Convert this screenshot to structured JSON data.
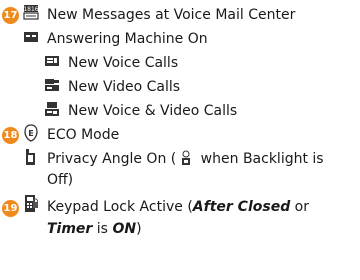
{
  "accent_color": "#f08a1c",
  "items": [
    {
      "number": "17",
      "icon": "voice-mail-center-icon",
      "text": "New Messages at Voice Mail Center"
    },
    {
      "icon": "answering-machine-icon",
      "text": "Answering Machine On",
      "subitems": [
        {
          "icon": "new-voice-call-icon",
          "text": "New Voice Calls"
        },
        {
          "icon": "new-video-call-icon",
          "text": "New Video Calls"
        },
        {
          "icon": "new-voice-video-call-icon",
          "text": "New Voice & Video Calls"
        }
      ]
    },
    {
      "number": "18",
      "icon": "eco-mode-icon",
      "text": "ECO Mode"
    },
    {
      "icon": "privacy-angle-icon",
      "text_line1": "Privacy Angle On (",
      "inline_icon": "privacy-angle-backlight-off-icon",
      "text_line1_end": " when Backlight is",
      "text_line2": "Off)"
    },
    {
      "number": "19",
      "icon": "keypad-lock-icon",
      "text_line1_a": "Keypad Lock Active  (",
      "text_line1_b": "After Closed",
      "text_line1_c": " or",
      "text_line2_a": "Timer",
      "text_line2_b": " is ",
      "text_line2_c": "ON",
      "text_line2_d": ")"
    }
  ]
}
